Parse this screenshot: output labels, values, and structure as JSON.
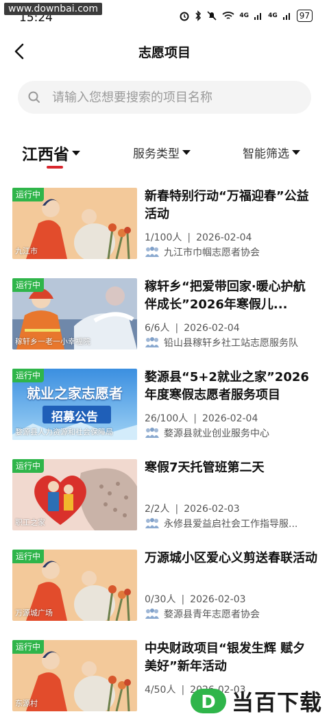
{
  "watermark_top": "www.downbai.com",
  "status_bar": {
    "time": "15:24",
    "battery": "97",
    "signal_labels": [
      "4G",
      "4G"
    ]
  },
  "nav": {
    "title": "志愿项目"
  },
  "search": {
    "placeholder": "请输入您想要搜索的项目名称",
    "value": ""
  },
  "filters": [
    {
      "label": "江西省",
      "active": true
    },
    {
      "label": "服务类型",
      "active": false
    },
    {
      "label": "智能筛选",
      "active": false
    }
  ],
  "items": [
    {
      "status": "运行中",
      "location": "九江市",
      "title": "新春特别行动“万福迎春”公益活动",
      "count": "1/100人",
      "date": "2026-02-04",
      "org": "九江市巾帼志愿者协会",
      "art": "salon"
    },
    {
      "status": "运行中",
      "location": "稼轩乡一老一小幸福院",
      "title": "稼轩乡“把爱带回家·暖心护航伴成长”2026年寒假儿...",
      "count": "6/6人",
      "date": "2026-02-04",
      "org": "铅山县稼轩乡社工站志愿服务队",
      "art": "firefighter"
    },
    {
      "status": "运行中",
      "location": "婺源县人力资源和社会保障局",
      "title": "婺源县“5+2就业之家”2026年度寒假志愿者服务项目",
      "count": "26/100人",
      "date": "2026-02-04",
      "org": "婺源县就业创业服务中心",
      "art": "poster",
      "poster_line1": "就业之家志愿者",
      "poster_line2": "招募公告"
    },
    {
      "status": "运行中",
      "location": "职工之家",
      "title": "寒假7天托管班第二天",
      "count": "2/2人",
      "date": "2026-02-03",
      "org": "永修县爱益启社会工作指导服...",
      "art": "family"
    },
    {
      "status": "运行中",
      "location": "万源城广场",
      "title": "万源城小区爱心义剪送春联活动",
      "count": "0/30人",
      "date": "2026-02-03",
      "org": "婺源县青年志愿者协会",
      "art": "salon"
    },
    {
      "status": "运行中",
      "location": "东源村",
      "title": "中央财政项目“银发生辉 赋夕美好”新年活动",
      "count": "4/50人",
      "date": "2026-02-03",
      "org": "",
      "art": "salon"
    }
  ],
  "brand": {
    "text": "当百下载",
    "logo_letter": "D"
  },
  "colors": {
    "accent": "#d8262d",
    "status_green": "#2fb54a"
  }
}
